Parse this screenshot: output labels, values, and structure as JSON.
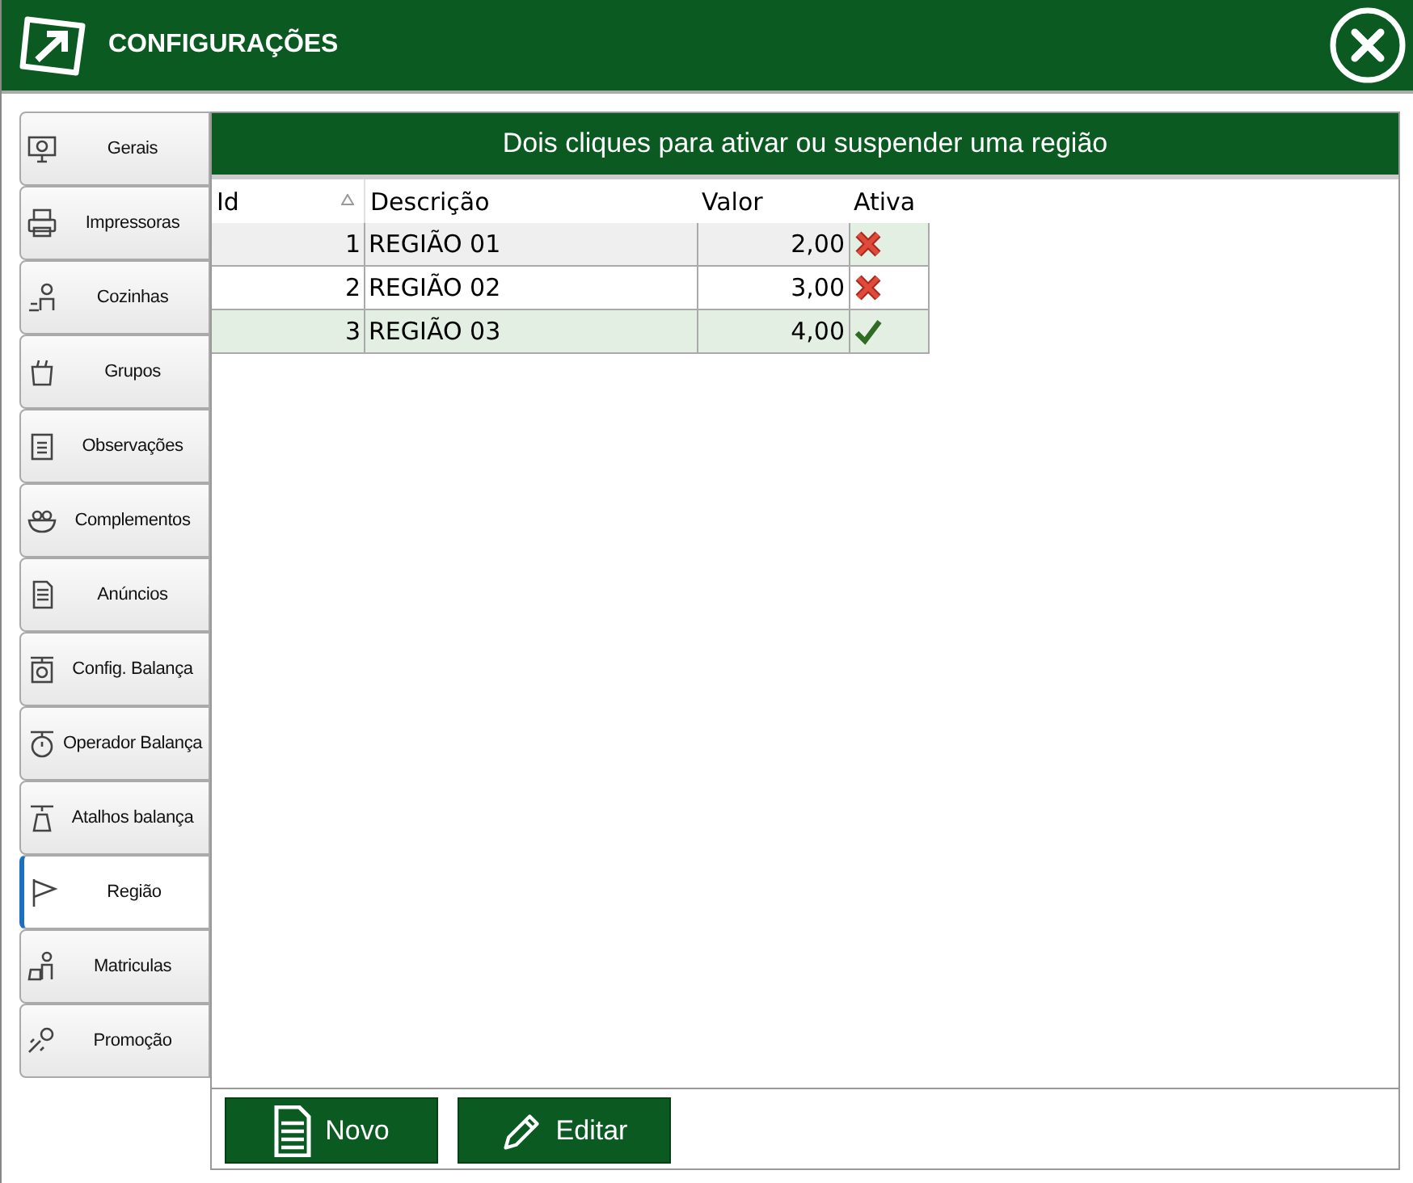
{
  "window": {
    "title": "CONFIGURAÇÕES"
  },
  "sidebar": {
    "items": [
      {
        "label": "Gerais",
        "selected": false
      },
      {
        "label": "Impressoras",
        "selected": false
      },
      {
        "label": "Cozinhas",
        "selected": false
      },
      {
        "label": "Grupos",
        "selected": false
      },
      {
        "label": "Observações",
        "selected": false
      },
      {
        "label": "Complementos",
        "selected": false
      },
      {
        "label": "Anúncios",
        "selected": false
      },
      {
        "label": "Config. Balança",
        "selected": false
      },
      {
        "label": "Operador  Balança",
        "selected": false
      },
      {
        "label": "Atalhos balança",
        "selected": false
      },
      {
        "label": "Região",
        "selected": true
      },
      {
        "label": "Matriculas",
        "selected": false
      },
      {
        "label": "Promoção",
        "selected": false
      }
    ]
  },
  "banner": "Dois cliques para ativar ou suspender uma região",
  "table": {
    "columns": [
      {
        "label": "Id",
        "sorted": true
      },
      {
        "label": "Descrição",
        "sorted": false
      },
      {
        "label": "Valor",
        "sorted": false
      },
      {
        "label": "Ativa",
        "sorted": false
      }
    ],
    "rows": [
      {
        "id": "1",
        "descricao": "REGIÃO 01",
        "valor": "2,00",
        "ativa": false,
        "selected": true
      },
      {
        "id": "2",
        "descricao": "REGIÃO 02",
        "valor": "3,00",
        "ativa": false,
        "selected": false
      },
      {
        "id": "3",
        "descricao": "REGIÃO 03",
        "valor": "4,00",
        "ativa": true,
        "selected": false
      }
    ]
  },
  "buttons": [
    {
      "label": "Novo",
      "kind": "new"
    },
    {
      "label": "Editar",
      "kind": "edit"
    }
  ]
}
